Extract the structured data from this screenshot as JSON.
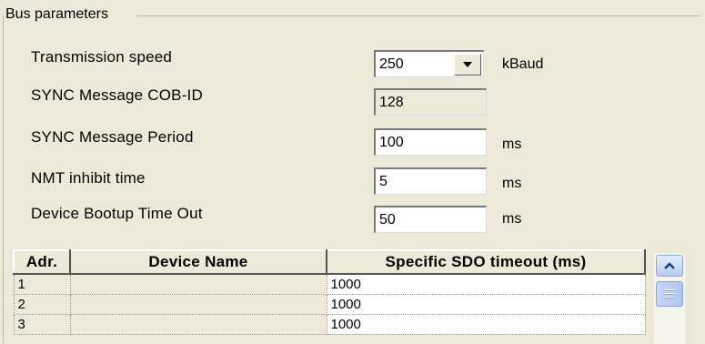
{
  "group": {
    "title": "Bus parameters"
  },
  "params": {
    "transmission_speed": {
      "label": "Transmission speed",
      "value": "250",
      "unit": "kBaud"
    },
    "sync_cob_id": {
      "label": "SYNC Message COB-ID",
      "value": "128"
    },
    "sync_period": {
      "label": "SYNC Message Period",
      "value": "100",
      "unit": "ms"
    },
    "nmt_inhibit": {
      "label": "NMT inhibit time",
      "value": "5",
      "unit": "ms"
    },
    "bootup_timeout": {
      "label": "Device Bootup Time Out",
      "value": "50",
      "unit": "ms"
    }
  },
  "table": {
    "headers": {
      "adr": "Adr.",
      "name": "Device Name",
      "timeout": "Specific SDO timeout (ms)"
    },
    "rows": [
      {
        "adr": "1",
        "name": "",
        "timeout": "1000"
      },
      {
        "adr": "2",
        "name": "",
        "timeout": "1000"
      },
      {
        "adr": "3",
        "name": "",
        "timeout": "1000"
      }
    ]
  },
  "icons": {
    "dropdown": "chevron-down-icon",
    "scroll_up": "chevron-up-icon",
    "scroll_thumb": "grip-icon"
  }
}
